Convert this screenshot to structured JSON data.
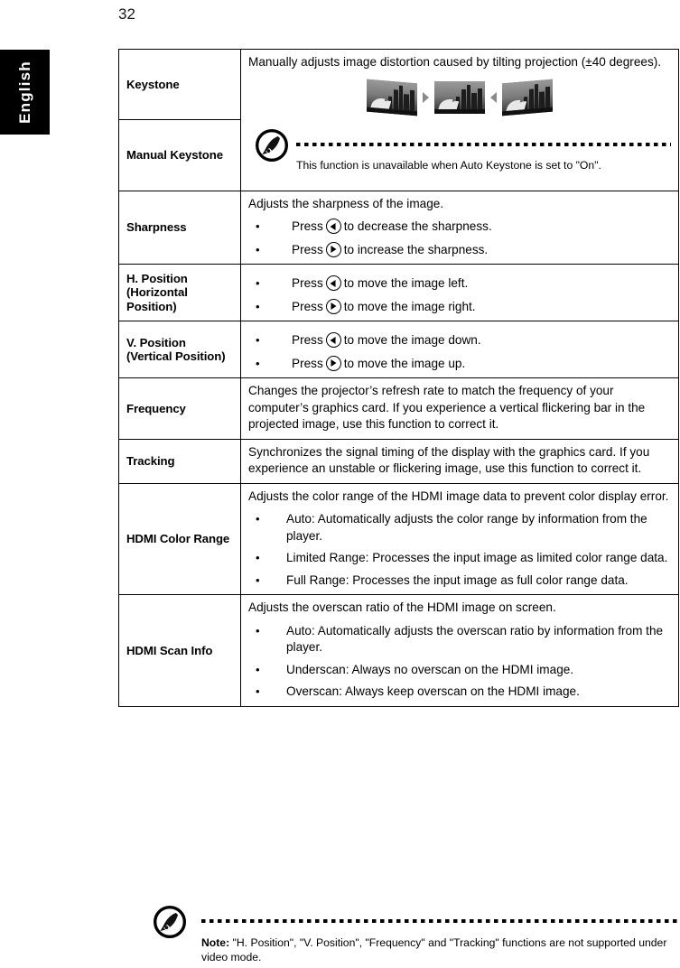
{
  "page": {
    "number": "32",
    "language_tab": "English"
  },
  "table": {
    "rows": [
      {
        "name": "Keystone",
        "desc_intro": "Manually adjusts image distortion caused by tilting projection (±40 degrees)."
      },
      {
        "name": "Manual Keystone",
        "figure": "keystone-correction-illustration",
        "note": {
          "icon": "acer-note-icon",
          "text": "This function is unavailable when Auto Keystone is set to \"On\"."
        }
      },
      {
        "name": "Sharpness",
        "desc_intro": "Adjusts the sharpness of the image.",
        "bullets": [
          {
            "pre": "Press",
            "key": "left-arrow-key",
            "post": "to decrease the sharpness."
          },
          {
            "pre": "Press",
            "key": "right-arrow-key",
            "post": "to increase the sharpness."
          }
        ]
      },
      {
        "name": "H. Position (Horizontal Position)",
        "bullets": [
          {
            "pre": "Press",
            "key": "left-arrow-key",
            "post": "to move the image left."
          },
          {
            "pre": "Press",
            "key": "right-arrow-key",
            "post": "to move the image right."
          }
        ]
      },
      {
        "name": "V. Position (Vertical Position)",
        "bullets": [
          {
            "pre": "Press",
            "key": "left-arrow-key",
            "post": "to move the image down."
          },
          {
            "pre": "Press",
            "key": "right-arrow-key",
            "post": "to move the image up."
          }
        ]
      },
      {
        "name": "Frequency",
        "desc_intro": "Changes the projector’s refresh rate to match the frequency of your computer’s graphics card. If you experience a vertical flickering bar in the projected image, use this function to correct it."
      },
      {
        "name": "Tracking",
        "desc_intro": "Synchronizes the signal timing of the display with the graphics card. If you experience an unstable or flickering image, use this function to correct it."
      },
      {
        "name": "HDMI Color Range",
        "desc_intro": "Adjusts the color range of the HDMI image data to prevent color display error.",
        "bullets_plain": [
          "Auto: Automatically adjusts the color range by information from the player.",
          "Limited Range: Processes the input image as limited color range data.",
          "Full Range: Processes the input image as full color range data."
        ]
      },
      {
        "name": "HDMI Scan Info",
        "desc_intro": "Adjusts the overscan ratio of the HDMI image on screen.",
        "bullets_plain": [
          "Auto: Automatically adjusts the overscan ratio by information from the player.",
          "Underscan: Always no overscan on the HDMI image.",
          "Overscan: Always keep overscan on the HDMI image."
        ]
      }
    ]
  },
  "bottom_note": {
    "icon": "acer-note-icon",
    "label": "Note:",
    "text": " \"H. Position\", \"V. Position\", \"Frequency\" and \"Tracking\" functions are not supported under video mode."
  },
  "bullet_char": "•",
  "colors": {
    "text": "#000000",
    "tab_background": "#000000",
    "tab_text": "#ffffff",
    "rule": "#000000",
    "page_background": "#ffffff"
  }
}
